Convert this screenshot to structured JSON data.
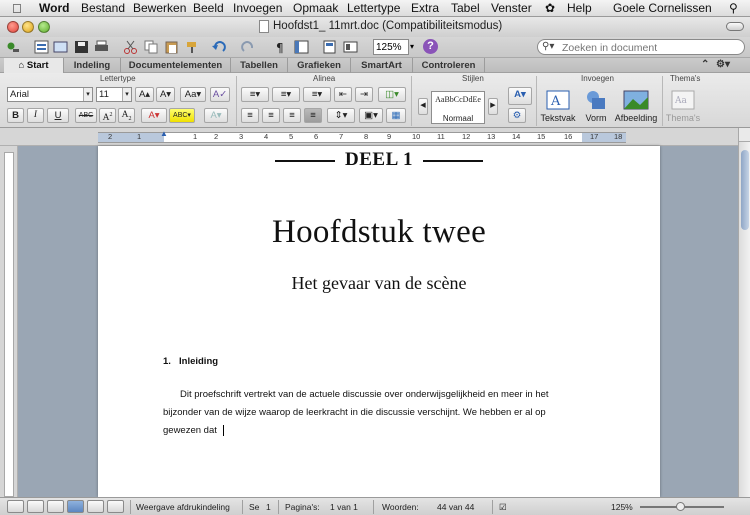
{
  "menubar": {
    "app_name": "Word",
    "items": [
      "Bestand",
      "Bewerken",
      "Beeld",
      "Invoegen",
      "Opmaak",
      "Lettertype",
      "Extra",
      "Tabel",
      "Venster",
      "Help"
    ],
    "user": "Goele Cornelissen"
  },
  "window": {
    "title": "Hoofdst1_ 11mrt.doc (Compatibiliteitsmodus)"
  },
  "toolbar": {
    "zoom": "125%",
    "search_placeholder": "Zoeken in document",
    "help_label": "?"
  },
  "ribbon_tabs": {
    "active": "Start",
    "items": [
      "Start",
      "Indeling",
      "Documentelementen",
      "Tabellen",
      "Grafieken",
      "SmartArt",
      "Controleren"
    ]
  },
  "ribbon": {
    "groups": {
      "font": "Lettertype",
      "paragraph": "Alinea",
      "styles": "Stijlen",
      "insert": "Invoegen",
      "themes": "Thema's"
    },
    "font_name": "Arial",
    "font_size": "11",
    "style_preview": "AaBbCcDdEe",
    "style_name": "Normaal",
    "insert_items": [
      "Tekstvak",
      "Vorm",
      "Afbeelding"
    ],
    "themes_label": "Thema's",
    "buttons": {
      "bold": "B",
      "italic": "I",
      "underline": "U",
      "strike": "ABC",
      "upper": "A",
      "lower": "A",
      "grow": "A",
      "shrink": "A",
      "case": "Aa",
      "clear": "A"
    }
  },
  "ruler": {
    "numbers": [
      "2",
      "1",
      "1",
      "2",
      "3",
      "4",
      "5",
      "6",
      "7",
      "8",
      "9",
      "10",
      "11",
      "12",
      "13",
      "14",
      "15",
      "16",
      "17",
      "18"
    ]
  },
  "document": {
    "part": "DEEL 1",
    "chapter": "Hoofdstuk twee",
    "subtitle": "Het gevaar van de scène",
    "section_number": "1.",
    "section_title": "Inleiding",
    "paragraph_lines": [
      "Dit proefschrift vertrekt van de actuele discussie over onderwijsgelijkheid en meer in het",
      "bijzonder van de wijze waarop de leerkracht in die discussie verschijnt. We hebben er al op",
      "gewezen dat"
    ]
  },
  "statusbar": {
    "view_name": "Weergave afdrukindeling",
    "section_label": "Se",
    "section_value": "1",
    "pages_label": "Pagina's:",
    "pages_value": "1 van 1",
    "words_label": "Woorden:",
    "words_value": "44 van 44",
    "zoom": "125%"
  }
}
